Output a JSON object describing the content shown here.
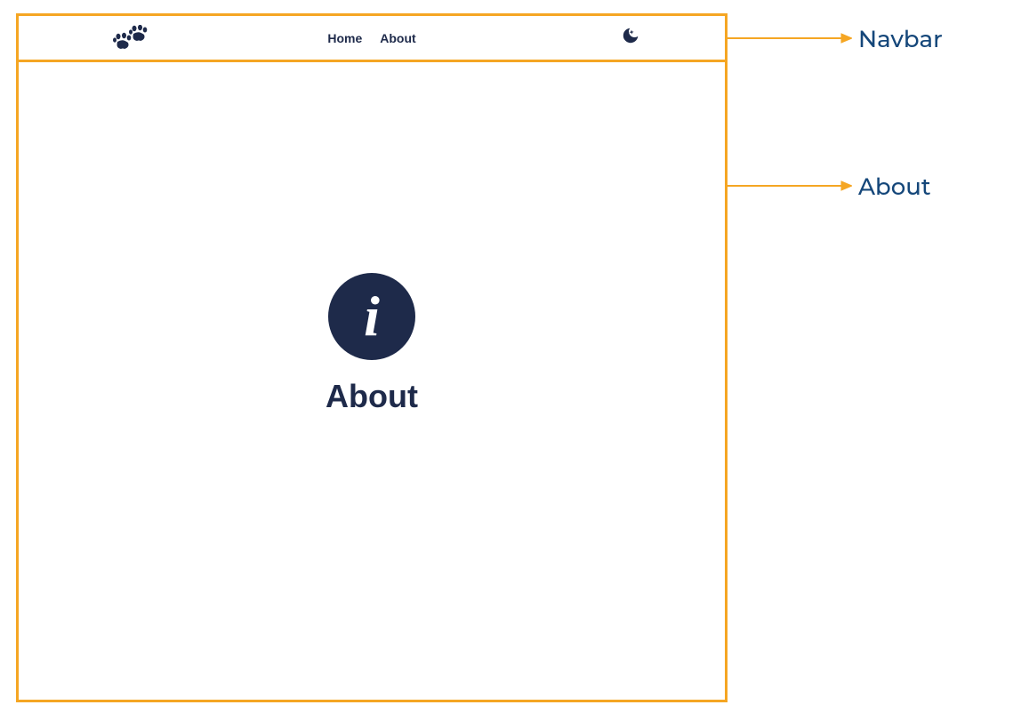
{
  "navbar": {
    "logo_name": "paw-icon",
    "links": [
      {
        "label": "Home"
      },
      {
        "label": "About"
      }
    ],
    "theme_toggle_name": "moon-icon"
  },
  "main": {
    "icon_name": "info-icon",
    "heading": "About"
  },
  "annotations": {
    "navbar": "Navbar",
    "about": "About"
  }
}
